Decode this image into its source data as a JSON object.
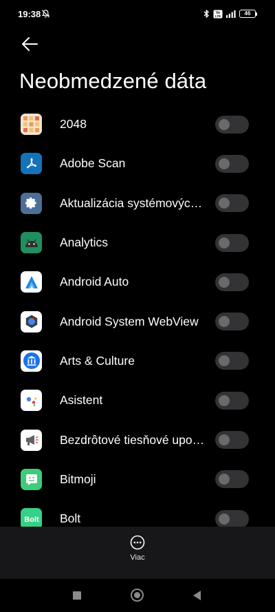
{
  "status_bar": {
    "time": "19:38",
    "battery": "46",
    "network_badge": "Vo\nLTE"
  },
  "page": {
    "title": "Neobmedzené dáta"
  },
  "apps": [
    {
      "label": "2048",
      "icon": "2048-icon",
      "enabled": false
    },
    {
      "label": "Adobe Scan",
      "icon": "adobe-scan-icon",
      "enabled": false
    },
    {
      "label": "Aktualizácia systémových...",
      "icon": "system-update-icon",
      "enabled": false
    },
    {
      "label": "Analytics",
      "icon": "android-analytics-icon",
      "enabled": false
    },
    {
      "label": "Android Auto",
      "icon": "android-auto-icon",
      "enabled": false
    },
    {
      "label": "Android System WebView",
      "icon": "webview-icon",
      "enabled": false
    },
    {
      "label": "Arts & Culture",
      "icon": "arts-culture-icon",
      "enabled": false
    },
    {
      "label": "Asistent",
      "icon": "google-assistant-icon",
      "enabled": false
    },
    {
      "label": "Bezdrôtové tiesňové upozornenia",
      "icon": "emergency-alerts-icon",
      "enabled": false
    },
    {
      "label": "Bitmoji",
      "icon": "bitmoji-icon",
      "enabled": false
    },
    {
      "label": "Bolt",
      "icon": "bolt-icon",
      "enabled": false
    }
  ],
  "bottom": {
    "more_label": "Viac"
  },
  "colors": {
    "background": "#000000",
    "panel": "#171719",
    "toggle_track": "#333336",
    "toggle_knob": "#6a6a6d"
  }
}
